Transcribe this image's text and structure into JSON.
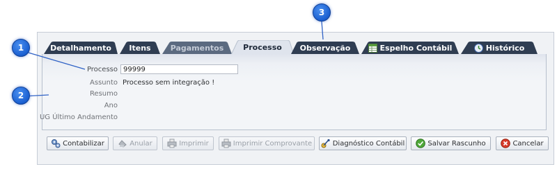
{
  "tabs": [
    {
      "label": "Detalhamento",
      "state": "normal",
      "icon": ""
    },
    {
      "label": "Itens",
      "state": "normal",
      "icon": ""
    },
    {
      "label": "Pagamentos",
      "state": "disabled",
      "icon": ""
    },
    {
      "label": "Processo",
      "state": "active",
      "icon": ""
    },
    {
      "label": "Observação",
      "state": "normal",
      "icon": ""
    },
    {
      "label": "Espelho Contábil",
      "state": "normal",
      "icon": "spreadsheet-icon"
    },
    {
      "label": "Histórico",
      "state": "normal",
      "icon": "history-icon"
    }
  ],
  "form": {
    "processo": {
      "label": "Processo",
      "value": "99999"
    },
    "assunto": {
      "label": "Assunto",
      "value": "Processo sem integração !"
    },
    "resumo": {
      "label": "Resumo",
      "value": ""
    },
    "ano": {
      "label": "Ano",
      "value": ""
    },
    "ug": {
      "label": "UG Último Andamento",
      "value": ""
    }
  },
  "buttons": [
    {
      "label": "Contabilizar",
      "enabled": true,
      "icon": "gears-icon"
    },
    {
      "label": "Anular",
      "enabled": false,
      "icon": "anular-icon"
    },
    {
      "label": "Imprimir",
      "enabled": false,
      "icon": "printer-icon"
    },
    {
      "label": "Imprimir Comprovante",
      "enabled": false,
      "icon": "printer-icon"
    },
    {
      "label": "Diagnóstico Contábil",
      "enabled": true,
      "icon": "diagnostic-icon"
    },
    {
      "label": "Salvar Rascunho",
      "enabled": true,
      "icon": "check-icon"
    },
    {
      "label": "Cancelar",
      "enabled": true,
      "icon": "cancel-icon"
    }
  ],
  "callouts": [
    {
      "number": "1"
    },
    {
      "number": "2"
    },
    {
      "number": "3"
    }
  ],
  "colors": {
    "tab_normal": "#2f3d52",
    "tab_active": "#f3f5f8",
    "callout": "#1a5fd0"
  }
}
